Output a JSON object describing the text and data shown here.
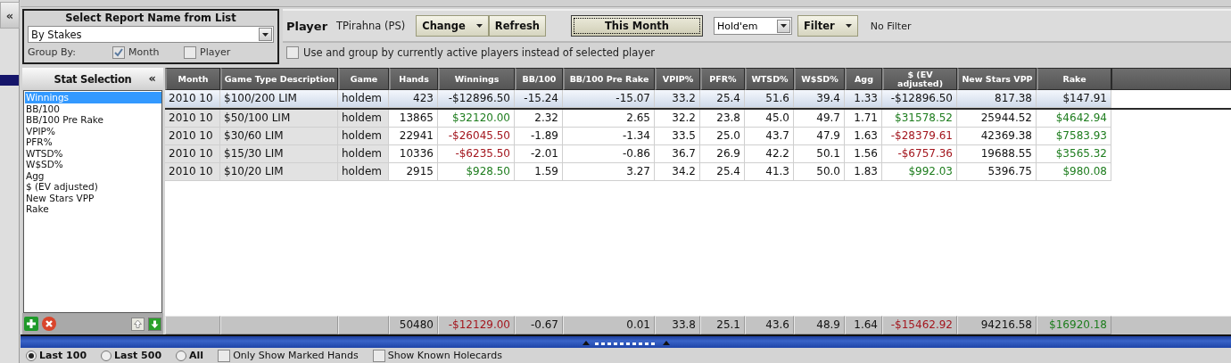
{
  "sidebar": {
    "collapse_button": "«"
  },
  "report": {
    "title": "Select Report Name from List",
    "value": "By Stakes",
    "group_by_label": "Group By:",
    "group_by": [
      {
        "label": "Month",
        "checked": true
      },
      {
        "label": "Player",
        "checked": false
      }
    ]
  },
  "player": {
    "label": "Player",
    "name": "TPirahna (PS)"
  },
  "toolbar": [
    {
      "kind": "button",
      "label": "Change",
      "dropdown": true,
      "focused": false
    },
    {
      "kind": "button",
      "label": "Refresh",
      "dropdown": false,
      "focused": false
    },
    {
      "kind": "button",
      "label": "This Month",
      "dropdown": false,
      "focused": true
    },
    {
      "kind": "select",
      "label": "Hold'em"
    },
    {
      "kind": "button",
      "label": "Filter",
      "dropdown": true,
      "focused": false
    },
    {
      "kind": "text",
      "label": "No Filter"
    }
  ],
  "active_players": {
    "label": "Use and group by currently active players instead of selected player",
    "checked": false
  },
  "stat_selection": {
    "title": "Stat Selection",
    "collapse_button": "«",
    "items": [
      {
        "label": "Winnings",
        "selected": true
      },
      {
        "label": "BB/100",
        "selected": false
      },
      {
        "label": "BB/100 Pre Rake",
        "selected": false
      },
      {
        "label": "VPIP%",
        "selected": false
      },
      {
        "label": "PFR%",
        "selected": false
      },
      {
        "label": "WTSD%",
        "selected": false
      },
      {
        "label": "W$SD%",
        "selected": false
      },
      {
        "label": "Agg",
        "selected": false
      },
      {
        "label": "$ (EV adjusted)",
        "selected": false
      },
      {
        "label": "New Stars VPP",
        "selected": false
      },
      {
        "label": "Rake",
        "selected": false
      }
    ]
  },
  "table": {
    "columns": [
      "Month",
      "Game Type Description",
      "Game",
      "Hands",
      "Winnings",
      "BB/100",
      "BB/100 Pre Rake",
      "VPIP%",
      "PFR%",
      "WTSD%",
      "W$SD%",
      "Agg",
      "$ (EV adjusted)",
      "New Stars VPP",
      "Rake"
    ],
    "rows": [
      {
        "selected": true,
        "cells": [
          "2010 10",
          "$100/200 LIM",
          "holdem",
          "423",
          "-$12896.50",
          "-15.24",
          "-15.07",
          "33.2",
          "25.4",
          "51.6",
          "39.4",
          "1.33",
          "-$12896.50",
          "817.38",
          "$147.91"
        ]
      },
      {
        "selected": false,
        "cells": [
          "2010 10",
          "$50/100 LIM",
          "holdem",
          "13865",
          {
            "text": "$32120.00",
            "color": "#1e7d1e"
          },
          "2.32",
          "2.65",
          "32.2",
          "23.8",
          "45.0",
          "49.7",
          "1.71",
          {
            "text": "$31578.52",
            "color": "#1e7d1e"
          },
          "25944.52",
          {
            "text": "$4642.94",
            "color": "#1e7d1e"
          }
        ]
      },
      {
        "selected": false,
        "cells": [
          "2010 10",
          "$30/60 LIM",
          "holdem",
          "22941",
          {
            "text": "-$26045.50",
            "color": "#a3161e"
          },
          "-1.89",
          "-1.34",
          "33.5",
          "25.0",
          "43.7",
          "47.9",
          "1.63",
          {
            "text": "-$28379.61",
            "color": "#a3161e"
          },
          "42369.38",
          {
            "text": "$7583.93",
            "color": "#1e7d1e"
          }
        ]
      },
      {
        "selected": false,
        "cells": [
          "2010 10",
          "$15/30 LIM",
          "holdem",
          "10336",
          {
            "text": "-$6235.50",
            "color": "#a3161e"
          },
          "-2.01",
          "-0.86",
          "36.7",
          "26.9",
          "42.2",
          "50.1",
          "1.56",
          {
            "text": "-$6757.36",
            "color": "#a3161e"
          },
          "19688.55",
          {
            "text": "$3565.32",
            "color": "#1e7d1e"
          }
        ]
      },
      {
        "selected": false,
        "cells": [
          "2010 10",
          "$10/20 LIM",
          "holdem",
          "2915",
          {
            "text": "$928.50",
            "color": "#1e7d1e"
          },
          "1.59",
          "3.27",
          "34.2",
          "25.4",
          "41.3",
          "50.0",
          "1.83",
          {
            "text": "$992.03",
            "color": "#1e7d1e"
          },
          "5396.75",
          {
            "text": "$980.08",
            "color": "#1e7d1e"
          }
        ]
      }
    ],
    "totals": [
      "50480",
      {
        "text": "-$12129.00",
        "color": "#a3161e"
      },
      "-0.67",
      "0.01",
      "33.8",
      "25.1",
      "43.6",
      "48.9",
      "1.64",
      {
        "text": "-$15462.92",
        "color": "#a3161e"
      },
      "94216.58",
      {
        "text": "$16920.18",
        "color": "#1e7d1e"
      }
    ]
  },
  "bottom_bar": [
    {
      "kind": "radio",
      "label": "Last 100",
      "selected": true
    },
    {
      "kind": "radio",
      "label": "Last 500",
      "selected": false
    },
    {
      "kind": "radio",
      "label": "All",
      "selected": false
    },
    {
      "kind": "checkbox",
      "label": "Only Show Marked Hands",
      "checked": false
    },
    {
      "kind": "checkbox",
      "label": "Show Known Holecards",
      "checked": false
    }
  ]
}
